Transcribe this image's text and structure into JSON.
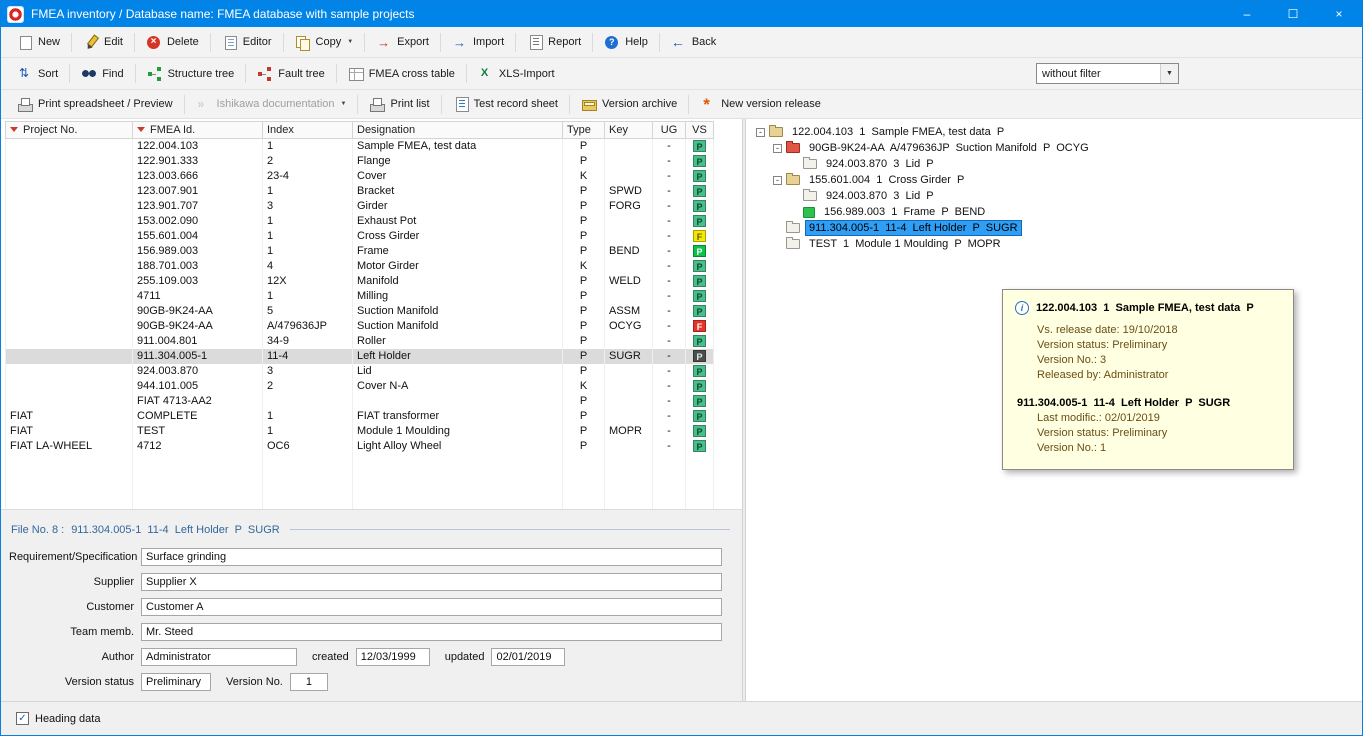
{
  "window": {
    "title": "FMEA inventory / Database name: FMEA database with sample projects",
    "controls": {
      "minimize": "–",
      "maximize": "☐",
      "close": "×"
    }
  },
  "colors": {
    "titlebar": "#0084e8",
    "tree_selection": "#2f9ef5",
    "tooltip_bg": "#ffffe1",
    "vs_green": "#49bd8b",
    "vs_bright_green": "#0cc24a",
    "vs_yellow": "#f4e800",
    "vs_red": "#e6362b"
  },
  "toolbar_main": [
    {
      "label": "New",
      "icon": "new"
    },
    {
      "label": "Edit",
      "icon": "edit"
    },
    {
      "label": "Delete",
      "icon": "delete"
    },
    {
      "label": "Editor",
      "icon": "editor"
    },
    {
      "label": "Copy",
      "icon": "copy",
      "dropdown": true
    },
    {
      "label": "Export",
      "icon": "export"
    },
    {
      "label": "Import",
      "icon": "import"
    },
    {
      "label": "Report",
      "icon": "report"
    },
    {
      "label": "Help",
      "icon": "help"
    },
    {
      "label": "Back",
      "icon": "back"
    }
  ],
  "toolbar_tools": {
    "buttons": [
      {
        "label": "Sort",
        "icon": "sort"
      },
      {
        "label": "Find",
        "icon": "find"
      },
      {
        "label": "Structure tree",
        "icon": "structure-tree"
      },
      {
        "label": "Fault tree",
        "icon": "fault-tree"
      },
      {
        "label": "FMEA cross table",
        "icon": "cross-table"
      },
      {
        "label": "XLS-Import",
        "icon": "xls"
      }
    ],
    "filter": {
      "value": "without filter"
    }
  },
  "toolbar_print": [
    {
      "label": "Print spreadsheet / Preview",
      "icon": "printer"
    },
    {
      "label": "Ishikawa documentation",
      "icon": "ishikawa",
      "dropdown": true,
      "disabled": true
    },
    {
      "label": "Print list",
      "icon": "printer"
    },
    {
      "label": "Test record sheet",
      "icon": "sheet"
    },
    {
      "label": "Version archive",
      "icon": "archive"
    },
    {
      "label": "New version release",
      "icon": "release"
    }
  ],
  "table": {
    "columns": [
      "Project No.",
      "FMEA Id.",
      "Index",
      "Designation",
      "Type",
      "Key",
      "UG",
      "VS"
    ],
    "rows": [
      {
        "project": "",
        "id": "122.004.103",
        "index": "1",
        "designation": "Sample FMEA, test data",
        "type": "P",
        "key": "",
        "ug": "-",
        "vs": "P",
        "vs_color": "green"
      },
      {
        "project": "",
        "id": "122.901.333",
        "index": "2",
        "designation": "Flange",
        "type": "P",
        "key": "",
        "ug": "-",
        "vs": "P",
        "vs_color": "green"
      },
      {
        "project": "",
        "id": "123.003.666",
        "index": "23-4",
        "designation": "Cover",
        "type": "K",
        "key": "",
        "ug": "-",
        "vs": "P",
        "vs_color": "green"
      },
      {
        "project": "",
        "id": "123.007.901",
        "index": "1",
        "designation": "Bracket",
        "type": "P",
        "key": "SPWD",
        "ug": "-",
        "vs": "P",
        "vs_color": "green"
      },
      {
        "project": "",
        "id": "123.901.707",
        "index": "3",
        "designation": "Girder",
        "type": "P",
        "key": "FORG",
        "ug": "-",
        "vs": "P",
        "vs_color": "green"
      },
      {
        "project": "",
        "id": "153.002.090",
        "index": "1",
        "designation": "Exhaust Pot",
        "type": "P",
        "key": "",
        "ug": "-",
        "vs": "P",
        "vs_color": "green"
      },
      {
        "project": "",
        "id": "155.601.004",
        "index": "1",
        "designation": "Cross Girder",
        "type": "P",
        "key": "",
        "ug": "-",
        "vs": "F",
        "vs_color": "yellow"
      },
      {
        "project": "",
        "id": "156.989.003",
        "index": "1",
        "designation": "Frame",
        "type": "P",
        "key": "BEND",
        "ug": "-",
        "vs": "P",
        "vs_color": "brightgreen"
      },
      {
        "project": "",
        "id": "188.701.003",
        "index": "4",
        "designation": "Motor Girder",
        "type": "K",
        "key": "",
        "ug": "-",
        "vs": "P",
        "vs_color": "green"
      },
      {
        "project": "",
        "id": "255.109.003",
        "index": "12X",
        "designation": "Manifold",
        "type": "P",
        "key": "WELD",
        "ug": "-",
        "vs": "P",
        "vs_color": "green"
      },
      {
        "project": "",
        "id": "4711",
        "index": "1",
        "designation": "Milling",
        "type": "P",
        "key": "",
        "ug": "-",
        "vs": "P",
        "vs_color": "green"
      },
      {
        "project": "",
        "id": "90GB-9K24-AA",
        "index": "5",
        "designation": "Suction Manifold",
        "type": "P",
        "key": "ASSM",
        "ug": "-",
        "vs": "P",
        "vs_color": "green"
      },
      {
        "project": "",
        "id": "90GB-9K24-AA",
        "index": "A/479636JP",
        "designation": "Suction Manifold",
        "type": "P",
        "key": "OCYG",
        "ug": "-",
        "vs": "F",
        "vs_color": "red"
      },
      {
        "project": "",
        "id": "911.004.801",
        "index": "34-9",
        "designation": "Roller",
        "type": "P",
        "key": "",
        "ug": "-",
        "vs": "P",
        "vs_color": "green"
      },
      {
        "project": "",
        "id": "911.304.005-1",
        "index": "11-4",
        "designation": "Left Holder",
        "type": "P",
        "key": "SUGR",
        "ug": "-",
        "vs": "P",
        "vs_color": "dark",
        "selected": true
      },
      {
        "project": "",
        "id": "924.003.870",
        "index": "3",
        "designation": "Lid",
        "type": "P",
        "key": "",
        "ug": "-",
        "vs": "P",
        "vs_color": "green"
      },
      {
        "project": "",
        "id": "944.101.005",
        "index": "2",
        "designation": "Cover N-A",
        "type": "K",
        "key": "",
        "ug": "-",
        "vs": "P",
        "vs_color": "green"
      },
      {
        "project": "",
        "id": "FIAT 4713-AA2",
        "index": "",
        "designation": "",
        "type": "P",
        "key": "",
        "ug": "-",
        "vs": "P",
        "vs_color": "green"
      },
      {
        "project": "FIAT",
        "id": "COMPLETE",
        "index": "1",
        "designation": "FIAT transformer",
        "type": "P",
        "key": "",
        "ug": "-",
        "vs": "P",
        "vs_color": "green"
      },
      {
        "project": "FIAT",
        "id": "TEST",
        "index": "1",
        "designation": "Module 1 Moulding",
        "type": "P",
        "key": "MOPR",
        "ug": "-",
        "vs": "P",
        "vs_color": "green"
      },
      {
        "project": "FIAT LA-WHEEL",
        "id": "4712",
        "index": "OC6",
        "designation": "Light Alloy Wheel",
        "type": "P",
        "key": "",
        "ug": "-",
        "vs": "P",
        "vs_color": "green"
      }
    ]
  },
  "tree": {
    "items": [
      {
        "depth": 0,
        "expand": "-",
        "icon": "folder-manila",
        "label": "122.004.103  1  Sample FMEA, test data  P"
      },
      {
        "depth": 1,
        "expand": "-",
        "icon": "folder-red",
        "label": "90GB-9K24-AA  A/479636JP  Suction Manifold  P  OCYG"
      },
      {
        "depth": 2,
        "expand": "",
        "icon": "folder-gray",
        "label": "924.003.870  3  Lid  P"
      },
      {
        "depth": 1,
        "expand": "-",
        "icon": "folder-manila",
        "label": "155.601.004  1  Cross Girder  P"
      },
      {
        "depth": 2,
        "expand": "",
        "icon": "folder-gray",
        "label": "924.003.870  3  Lid  P"
      },
      {
        "depth": 2,
        "expand": "",
        "icon": "block-green",
        "label": "156.989.003  1  Frame  P  BEND"
      },
      {
        "depth": 1,
        "expand": "",
        "icon": "folder-gray",
        "label": "911.304.005-1  11-4  Left Holder  P  SUGR",
        "selected": true
      },
      {
        "depth": 1,
        "expand": "",
        "icon": "folder-gray",
        "label": "TEST  1  Module 1 Moulding  P  MOPR"
      }
    ]
  },
  "tooltip": {
    "title": "122.004.103  1  Sample FMEA, test data  P",
    "lines1": [
      "Vs. release date: 19/10/2018",
      "Version status: Preliminary",
      "Version No.: 3",
      "Released by: Administrator"
    ],
    "subtitle": "911.304.005-1  11-4  Left Holder  P  SUGR",
    "lines2": [
      "Last modific.: 02/01/2019",
      "Version status: Preliminary",
      "Version No.: 1"
    ]
  },
  "form": {
    "header_label": "File No. 8 :",
    "header_value": "911.304.005-1  11-4  Left Holder  P  SUGR",
    "fields": [
      {
        "label": "Requirement/Specification",
        "value": "Surface grinding"
      },
      {
        "label": "Supplier",
        "value": "Supplier X"
      },
      {
        "label": "Customer",
        "value": "Customer A"
      },
      {
        "label": "Team memb.",
        "value": "Mr. Steed"
      }
    ],
    "author": {
      "label": "Author",
      "value": "Administrator",
      "created_label": "created",
      "created": "12/03/1999",
      "updated_label": "updated",
      "updated": "02/01/2019"
    },
    "version": {
      "status_label": "Version status",
      "status": "Preliminary",
      "no_label": "Version No.",
      "no": "1"
    }
  },
  "statusbar": {
    "heading_data": "Heading data",
    "checked": true
  }
}
